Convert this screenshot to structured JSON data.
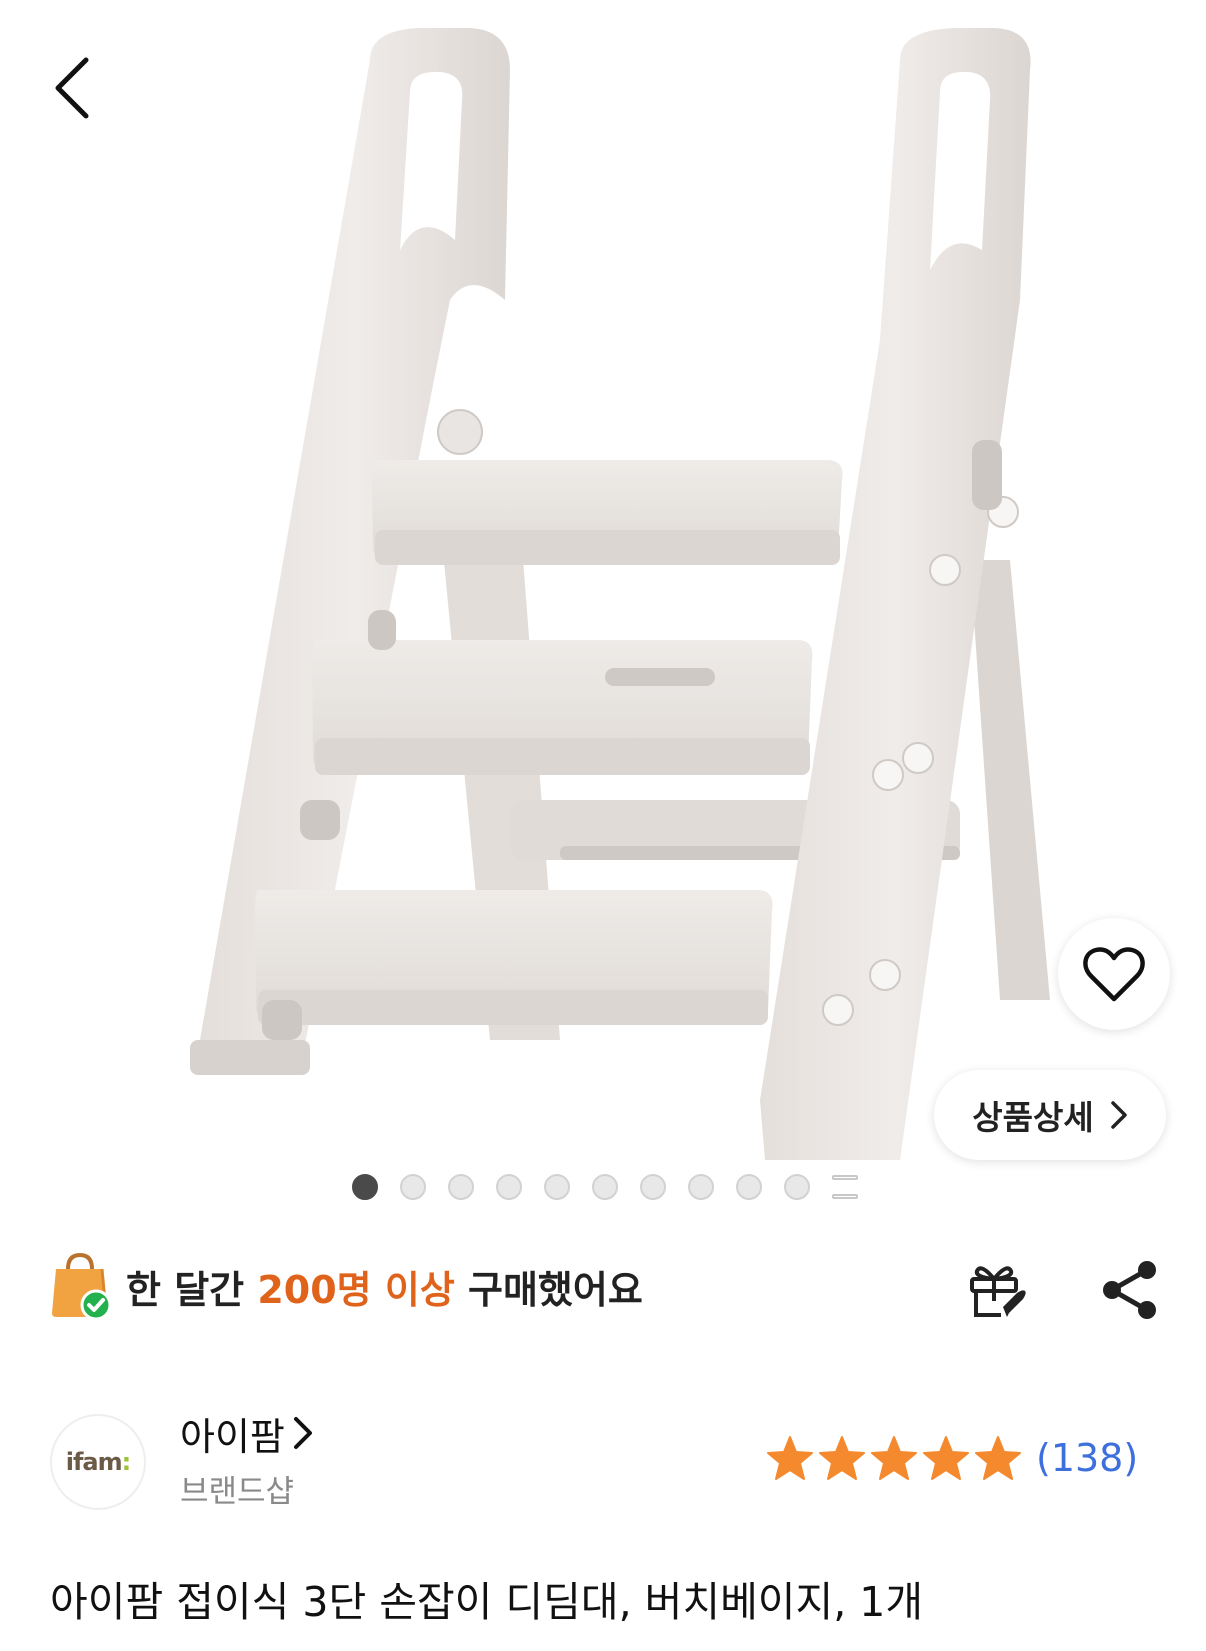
{
  "nav": {
    "back_icon": "chevron-left-icon"
  },
  "gallery": {
    "image_subject": "folding three-step stool with handles, beige",
    "total_dots": 10,
    "active_index": 0,
    "more_icon": "list-icon",
    "wish_icon": "heart-outline-icon",
    "detail_label": "상품상세"
  },
  "purchase_notice": {
    "icon": "shopping-bag-check-icon",
    "prefix": "한 달간 ",
    "highlight": "200명 이상",
    "suffix": " 구매했어요",
    "highlight_color": "#e0631b"
  },
  "actions": {
    "gift_icon": "gift-rocket-icon",
    "share_icon": "share-icon"
  },
  "seller": {
    "logo_text": "ifam",
    "name": "아이팜",
    "type": "브랜드샵"
  },
  "rating": {
    "stars": 5,
    "count_label": "(138)",
    "star_color": "#f5892e",
    "count_color": "#3d6fdd"
  },
  "product": {
    "title": "아이팜 접이식 3단 손잡이 디딤대, 버치베이지, 1개"
  }
}
